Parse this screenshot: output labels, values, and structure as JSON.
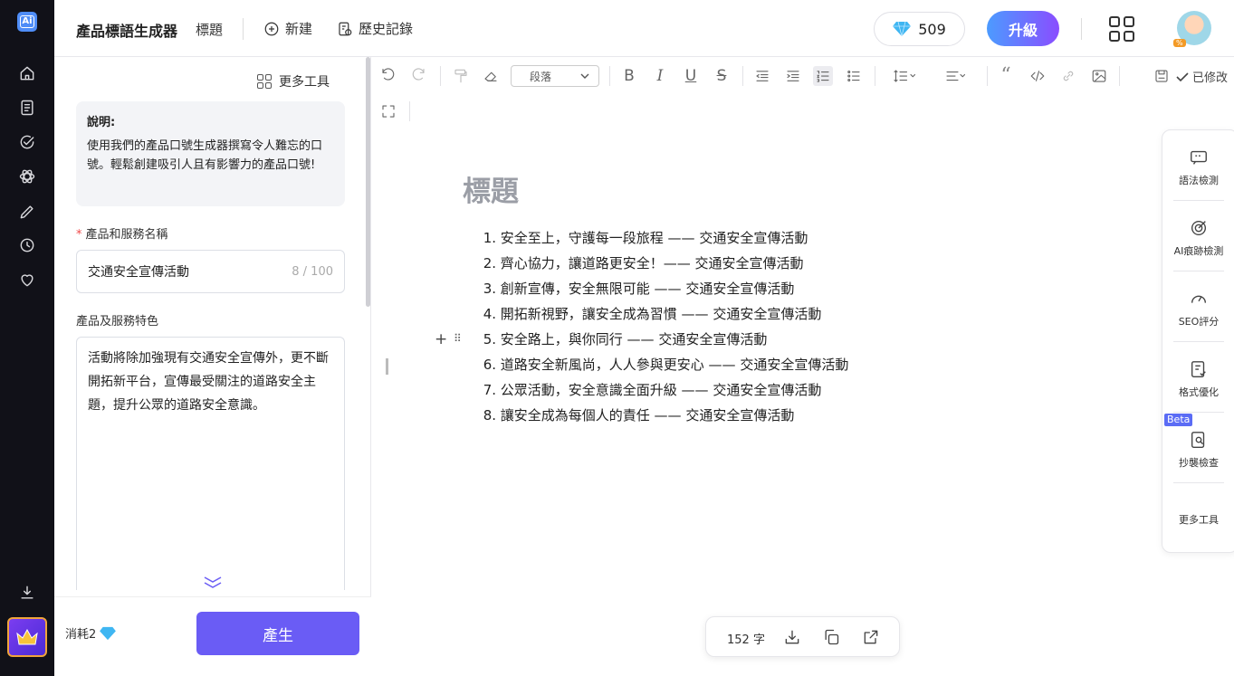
{
  "header": {
    "app_title": "產品標語生成器",
    "doc_title": "標題",
    "new_label": "新建",
    "history_label": "歷史記錄",
    "credits": "509",
    "upgrade_label": "升級",
    "avatar_badge": "%"
  },
  "form": {
    "more_tools": "更多工具",
    "desc_title": "說明:",
    "desc_text": "使用我們的產品口號生成器撰寫令人難忘的口號。輕鬆創建吸引人且有影響力的產品口號!",
    "name_label": "產品和服務名稱",
    "name_value": "交通安全宣傳活動",
    "name_count": "8 / 100",
    "features_label": "產品及服務特色",
    "features_value": "活動將除加強現有交通安全宣傳外，更不斷開拓新平台，宣傳最受關注的道路安全主題，提升公眾的道路安全意識。",
    "cost_label": "消耗2",
    "generate_label": "產生"
  },
  "toolbar": {
    "paragraph_label": "段落",
    "saved_label": "已修改"
  },
  "editor": {
    "heading": "標題",
    "items": [
      {
        "n": "1.",
        "text": "安全至上，守護每一段旅程 —— 交通安全宣傳活動"
      },
      {
        "n": "2.",
        "text": "齊心協力，讓道路更安全！—— 交通安全宣傳活動"
      },
      {
        "n": "3.",
        "text": "創新宣傳，安全無限可能 —— 交通安全宣傳活動"
      },
      {
        "n": "4.",
        "text": "開拓新視野，讓安全成為習慣 —— 交通安全宣傳活動"
      },
      {
        "n": "5.",
        "text": "安全路上，與你同行 —— 交通安全宣傳活動"
      },
      {
        "n": "6.",
        "text": "道路安全新風尚，人人參與更安心 —— 交通安全宣傳活動"
      },
      {
        "n": "7.",
        "text": "公眾活動，安全意識全面升級 —— 交通安全宣傳活動"
      },
      {
        "n": "8.",
        "text": "讓安全成為每個人的責任 —— 交通安全宣傳活動"
      }
    ]
  },
  "side_panel": {
    "grammar": "語法檢測",
    "ai_trace": "AI痕跡檢測",
    "seo": "SEO評分",
    "format": "格式優化",
    "beta": "Beta",
    "plagiarism": "抄襲檢查",
    "more": "更多工具"
  },
  "status": {
    "word_count": "152 字"
  },
  "colors": {
    "accent": "#6a5cf5",
    "rail_bg": "#111118",
    "required": "#f04a4a"
  }
}
